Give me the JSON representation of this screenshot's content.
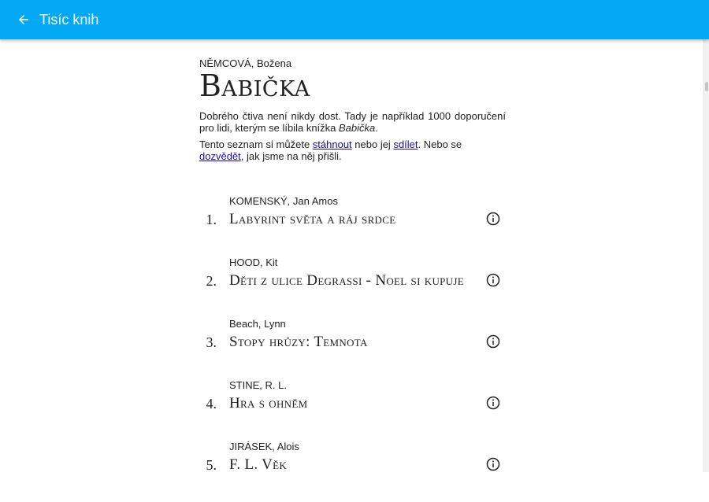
{
  "appbar": {
    "title": "Tisíc knih",
    "back_icon": "arrow-left-icon",
    "color": "#03a9f4"
  },
  "book": {
    "author": "NĚMCOVÁ, Božena",
    "title": "Babička"
  },
  "intro": {
    "p1_text": "Dobrého čtiva není nikdy dost. Tady je například 1000 doporučení pro lidi, kterým se líbila knížka ",
    "p1_book": "Babička",
    "p1_end": ".",
    "p2_text1": "Tento seznam si můžete ",
    "p2_link1": "stáhnout",
    "p2_text2": " nebo jej ",
    "p2_link2": "sdílet",
    "p2_text3": ". Nebo se ",
    "p2_link3": "dozvědět",
    "p2_text4": ", jak jsme na něj přišli."
  },
  "list": [
    {
      "num": "1.",
      "author": "KOMENSKÝ, Jan Amos",
      "title": "Labyrint světa a ráj srdce",
      "icon": "info-icon"
    },
    {
      "num": "2.",
      "author": "HOOD, Kit",
      "title": "Děti z ulice Degrassi - Noel si kupuje",
      "icon": "info-icon"
    },
    {
      "num": "3.",
      "author": "Beach, Lynn",
      "title": "Stopy hrůzy: Temnota",
      "icon": "info-icon"
    },
    {
      "num": "4.",
      "author": "STINE, R. L.",
      "title": "Hra s ohněm",
      "icon": "info-icon"
    },
    {
      "num": "5.",
      "author": "JIRÁSEK, Alois",
      "title": "F. L. Věk",
      "icon": "info-icon"
    }
  ]
}
